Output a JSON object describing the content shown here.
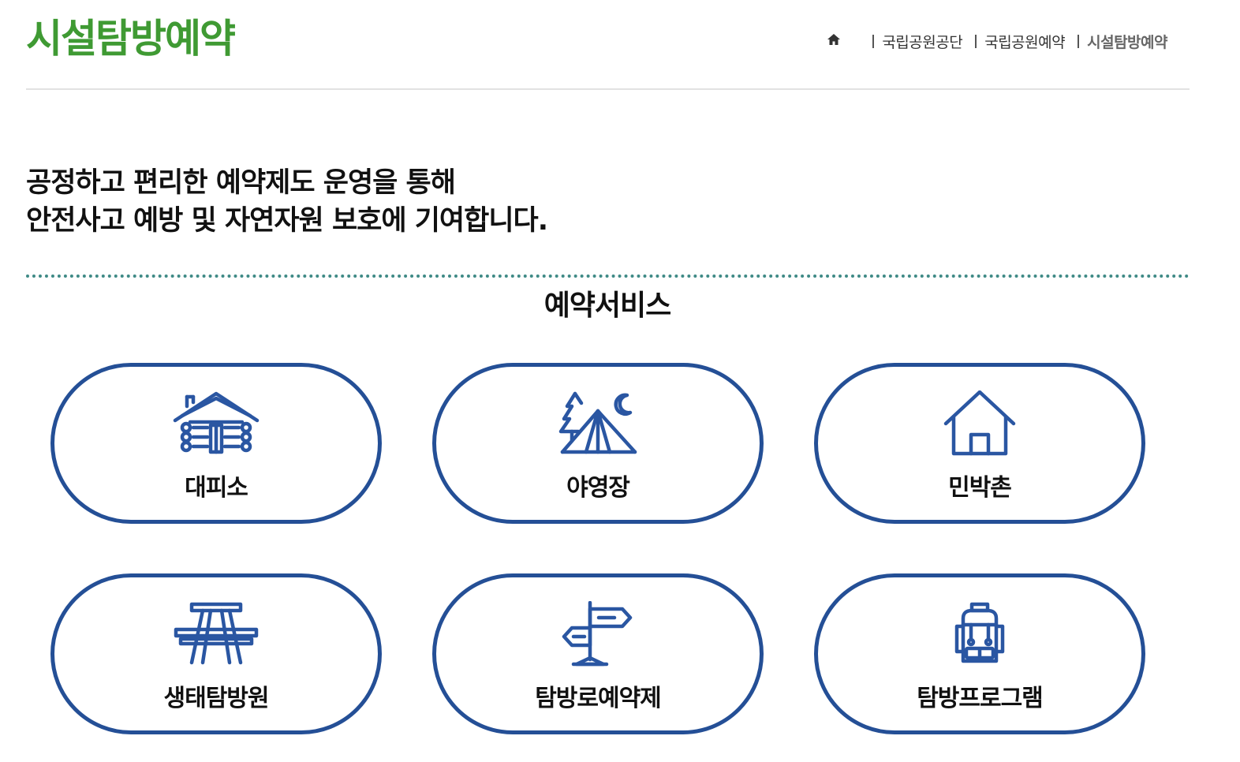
{
  "header": {
    "title": "시설탐방예약"
  },
  "breadcrumb": {
    "home_icon": "home-icon",
    "items": [
      {
        "label": "국립공원공단"
      },
      {
        "label": "국립공원예약"
      },
      {
        "label": "시설탐방예약"
      }
    ]
  },
  "intro": {
    "line1": "공정하고 편리한 예약제도 운영을 통해",
    "line2": "안전사고 예방 및 자연자원 보호에 기여합니다."
  },
  "services": {
    "title": "예약서비스",
    "items": [
      {
        "label": "대피소",
        "icon": "log-cabin-icon"
      },
      {
        "label": "야영장",
        "icon": "tent-camping-icon"
      },
      {
        "label": "민박촌",
        "icon": "house-icon"
      },
      {
        "label": "생태탐방원",
        "icon": "picnic-table-icon"
      },
      {
        "label": "탐방로예약제",
        "icon": "signpost-icon"
      },
      {
        "label": "탐방프로그램",
        "icon": "backpack-icon"
      }
    ]
  },
  "colors": {
    "title_green": "#3f9a33",
    "card_border_blue": "#244f96",
    "icon_blue": "#2a56a2",
    "dotted_rule_teal": "#3f8a86"
  }
}
